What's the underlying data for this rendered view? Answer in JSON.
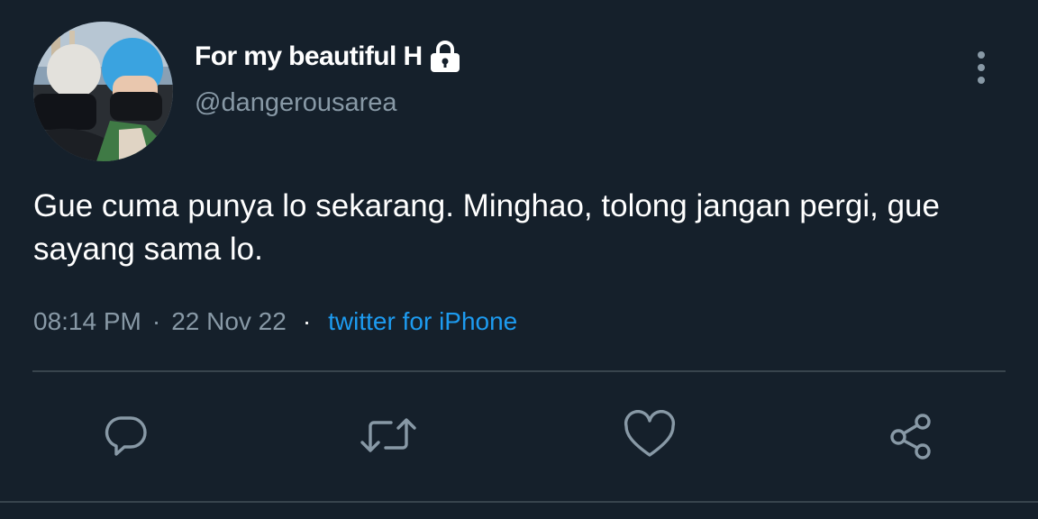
{
  "user": {
    "display_name": "For my beautiful H",
    "handle": "@dangerousarea",
    "protected": true,
    "avatar_icon": "avatar-photo"
  },
  "tweet": {
    "text": "Gue cuma punya lo sekarang. Minghao, tolong jangan pergi, gue sayang sama lo.",
    "time": "08:14 PM",
    "date": "22 Nov 22",
    "separator": "·",
    "source": "twitter for iPhone"
  },
  "actions": {
    "reply_icon": "reply-icon",
    "retweet_icon": "retweet-icon",
    "like_icon": "heart-icon",
    "share_icon": "share-icon"
  },
  "colors": {
    "background": "#15202b",
    "secondary_text": "#8899a6",
    "link": "#1d9bf0",
    "divider": "#38444d"
  }
}
